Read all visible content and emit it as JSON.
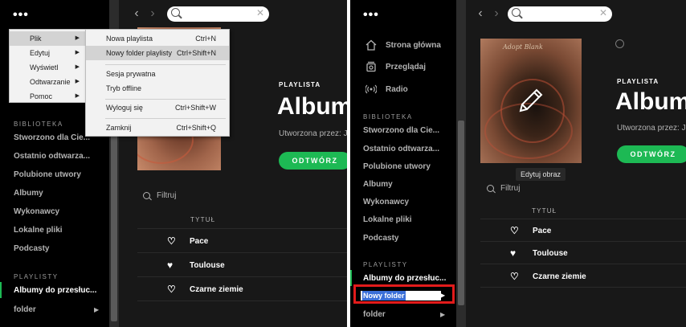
{
  "colors": {
    "accent": "#1db954",
    "highlight": "#e21b1b",
    "selection": "#3a6fd8"
  },
  "left": {
    "dots": "•••",
    "search_placeholder": "",
    "sidebar": {
      "library_heading": "BIBLIOTEKA",
      "library_items": [
        "Stworzono dla Cie...",
        "Ostatnio odtwarza...",
        "Polubione utwory",
        "Albumy",
        "Wykonawcy",
        "Lokalne pliki",
        "Podcasty"
      ],
      "playlists_heading": "PLAYLISTY",
      "playlists": [
        "Albumy do przesłuc...",
        "folder"
      ]
    },
    "menu": {
      "items": [
        "Plik",
        "Edytuj",
        "Wyświetl",
        "Odtwarzanie",
        "Pomoc"
      ]
    },
    "submenu": {
      "items": [
        {
          "label": "Nowa playlista",
          "shortcut": "Ctrl+N"
        },
        {
          "label": "Nowy folder playlisty",
          "shortcut": "Ctrl+Shift+N"
        },
        {
          "label": "Sesja prywatna",
          "shortcut": ""
        },
        {
          "label": "Tryb offline",
          "shortcut": ""
        },
        {
          "label": "Wyloguj się",
          "shortcut": "Ctrl+Shift+W"
        },
        {
          "label": "Zamknij",
          "shortcut": "Ctrl+Shift+Q"
        }
      ]
    },
    "playlist": {
      "type": "PLAYLISTA",
      "title": "Album",
      "by": "Utworzona przez: J",
      "open_button": "ODTWÓRZ",
      "filter": "Filtruj",
      "col_title": "TYTUŁ",
      "tracks": [
        "Pace",
        "Toulouse",
        "Czarne ziemie"
      ]
    }
  },
  "right": {
    "dots": "•••",
    "nav": [
      "Strona główna",
      "Przeglądaj",
      "Radio"
    ],
    "sidebar": {
      "library_heading": "BIBLIOTEKA",
      "library_items": [
        "Stworzono dla Cie...",
        "Ostatnio odtwarza...",
        "Polubione utwory",
        "Albumy",
        "Wykonawcy",
        "Lokalne pliki",
        "Podcasty"
      ],
      "playlists_heading": "PLAYLISTY",
      "playlists": [
        "Albumy do przesłuc...",
        "folder"
      ],
      "rename_value": "Nowy folder"
    },
    "cover_signature": "Adopt Blank",
    "tooltip": "Edytuj obraz",
    "playlist": {
      "type": "PLAYLISTA",
      "title": "Album",
      "by": "Utworzona przez: J",
      "open_button": "ODTWÓRZ",
      "filter": "Filtruj",
      "col_title": "TYTUŁ",
      "tracks": [
        "Pace",
        "Toulouse",
        "Czarne ziemie"
      ]
    }
  }
}
